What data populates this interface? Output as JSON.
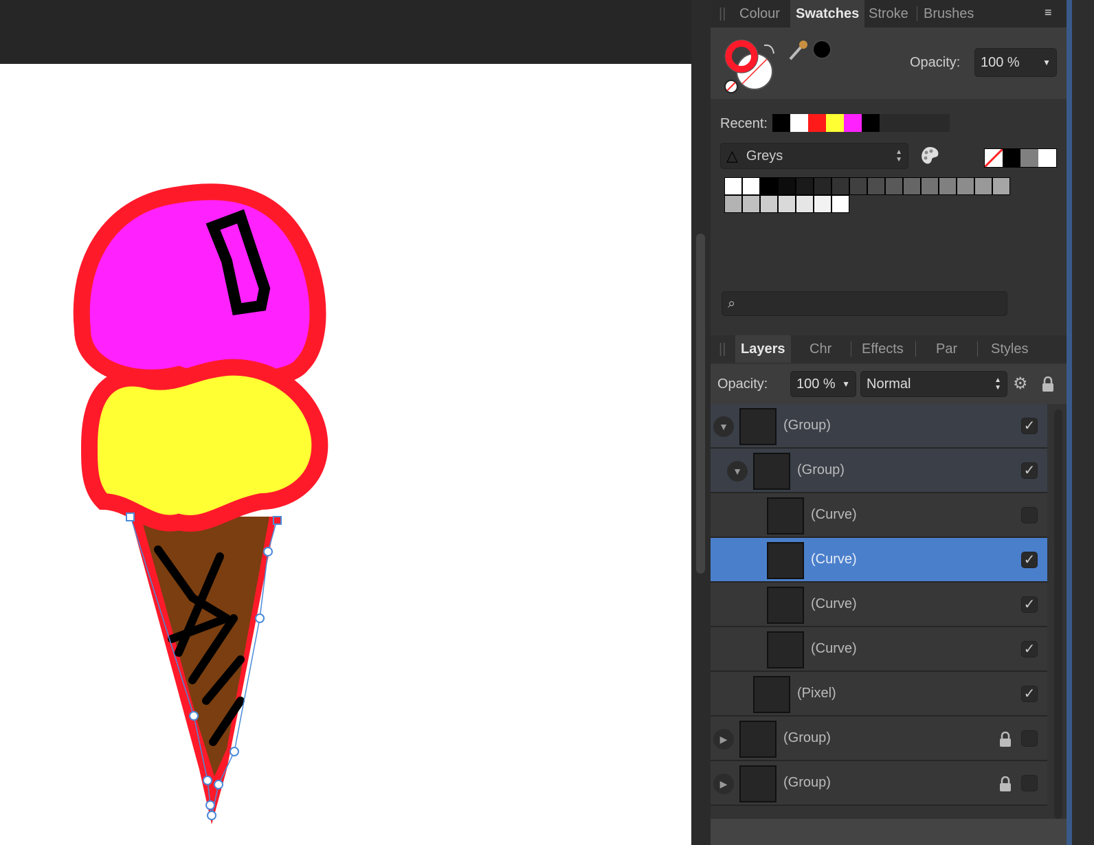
{
  "swatches_panel": {
    "tabs": [
      "Colour",
      "Swatches",
      "Stroke",
      "Brushes"
    ],
    "active_tab": "Swatches",
    "opacity_label": "Opacity:",
    "opacity_value": "100 %",
    "recent_label": "Recent:",
    "recent_colors": [
      "#000000",
      "#ffffff",
      "#ff1a1a",
      "#ffff33",
      "#ff22ff",
      "#000000"
    ],
    "palette_name": "Greys",
    "quick_colors": [
      "none",
      "#000000",
      "#808080",
      "#ffffff"
    ],
    "grey_swatches": [
      "#ffffff",
      "#ffffff",
      "#000000",
      "#0d0d0d",
      "#1a1a1a",
      "#262626",
      "#333333",
      "#404040",
      "#4d4d4d",
      "#595959",
      "#666666",
      "#737373",
      "#808080",
      "#8c8c8c",
      "#999999",
      "#a6a6a6",
      "#b3b3b3",
      "#c0c0c0",
      "#cccccc",
      "#d9d9d9",
      "#e6e6e6",
      "#f2f2f2",
      "#ffffff"
    ],
    "search_placeholder": ""
  },
  "layers_panel": {
    "tabs": [
      "Layers",
      "Chr",
      "Effects",
      "Par",
      "Styles"
    ],
    "active_tab": "Layers",
    "opacity_label": "Opacity:",
    "opacity_value": "100 %",
    "blend_mode": "Normal",
    "layers": [
      {
        "name": "(Group)",
        "visible": true,
        "expanded": true,
        "locked": false,
        "selected": false
      },
      {
        "name": "(Group)",
        "visible": true,
        "expanded": true,
        "locked": false,
        "selected": false
      },
      {
        "name": "(Curve)",
        "visible": false,
        "locked": false,
        "selected": false
      },
      {
        "name": "(Curve)",
        "visible": true,
        "locked": false,
        "selected": true
      },
      {
        "name": "(Curve)",
        "visible": true,
        "locked": false,
        "selected": false
      },
      {
        "name": "(Curve)",
        "visible": true,
        "locked": false,
        "selected": false
      },
      {
        "name": "(Pixel)",
        "visible": true,
        "locked": false,
        "selected": false
      },
      {
        "name": "(Group)",
        "visible": false,
        "expanded": false,
        "locked": true,
        "selected": false
      },
      {
        "name": "(Group)",
        "visible": false,
        "expanded": false,
        "locked": true,
        "selected": false
      }
    ]
  }
}
